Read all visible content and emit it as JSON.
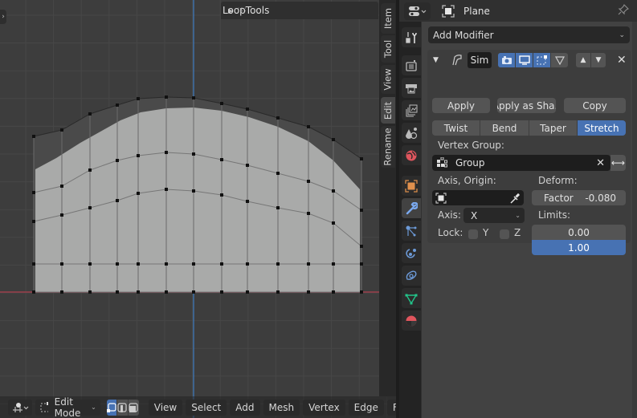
{
  "viewport": {
    "looptools_panel": {
      "label": "LoopTools",
      "collapsed": true
    },
    "sidebar_tabs": [
      {
        "label": "Item",
        "active": false
      },
      {
        "label": "Tool",
        "active": false
      },
      {
        "label": "View",
        "active": false
      },
      {
        "label": "Edit",
        "active": true
      },
      {
        "label": "Rename",
        "active": false
      }
    ],
    "header": {
      "mode": "Edit Mode",
      "select_modes": [
        {
          "name": "vertex",
          "active": true
        },
        {
          "name": "edge",
          "active": false
        },
        {
          "name": "face",
          "active": false
        }
      ],
      "menus": [
        "View",
        "Select",
        "Add",
        "Mesh",
        "Vertex",
        "Edge",
        "Fa"
      ]
    },
    "colors": {
      "background": "#3d3d3d",
      "mesh_face": "#a9aaa9",
      "ghost_face": "#4a4a4a",
      "vertex": "#111111",
      "x_axis": "#9c3f4b",
      "y_axis": "#3f7dc3"
    }
  },
  "properties": {
    "header": {
      "object_name": "Plane",
      "pinned": false
    },
    "tabs": [
      {
        "name": "tool",
        "icon": "tool-icon",
        "active": false
      },
      {
        "name": "render",
        "icon": "render-icon",
        "active": false
      },
      {
        "name": "output",
        "icon": "output-icon",
        "active": false
      },
      {
        "name": "view-layer",
        "icon": "view-layer-icon",
        "active": false
      },
      {
        "name": "scene",
        "icon": "scene-icon",
        "active": false
      },
      {
        "name": "world",
        "icon": "world-icon",
        "active": false
      },
      {
        "name": "object",
        "icon": "object-icon",
        "active": false
      },
      {
        "name": "modifiers",
        "icon": "wrench-icon",
        "active": true
      },
      {
        "name": "particles",
        "icon": "particles-icon",
        "active": false
      },
      {
        "name": "physics",
        "icon": "physics-icon",
        "active": false
      },
      {
        "name": "constraints",
        "icon": "constraints-icon",
        "active": false
      },
      {
        "name": "data",
        "icon": "mesh-data-icon",
        "active": false
      },
      {
        "name": "material",
        "icon": "material-icon",
        "active": false
      }
    ],
    "add_modifier_label": "Add Modifier",
    "modifier": {
      "name": "Sim",
      "expanded": true,
      "toggles": {
        "render": true,
        "viewport": true,
        "edit_mode": true,
        "on_cage": false
      },
      "actions": {
        "apply": "Apply",
        "apply_shape": "Apply as Sha..",
        "copy": "Copy"
      },
      "methods": [
        "Twist",
        "Bend",
        "Taper",
        "Stretch"
      ],
      "active_method": "Stretch",
      "vertex_group_label": "Vertex Group:",
      "vertex_group_value": "Group",
      "axis_origin_label": "Axis, Origin:",
      "origin_value": "",
      "axis_label": "Axis:",
      "axis_value": "X",
      "lock_label": "Lock:",
      "lock_y": {
        "label": "Y",
        "checked": false
      },
      "lock_z": {
        "label": "Z",
        "checked": false
      },
      "deform_label": "Deform:",
      "factor_label": "Factor",
      "factor_value": "-0.080",
      "limits_label": "Limits:",
      "limit_low": "0.00",
      "limit_high": "1.00"
    },
    "colors": {
      "accent": "#4772b3",
      "panel": "#3d3d3d",
      "button": "#545454"
    }
  }
}
